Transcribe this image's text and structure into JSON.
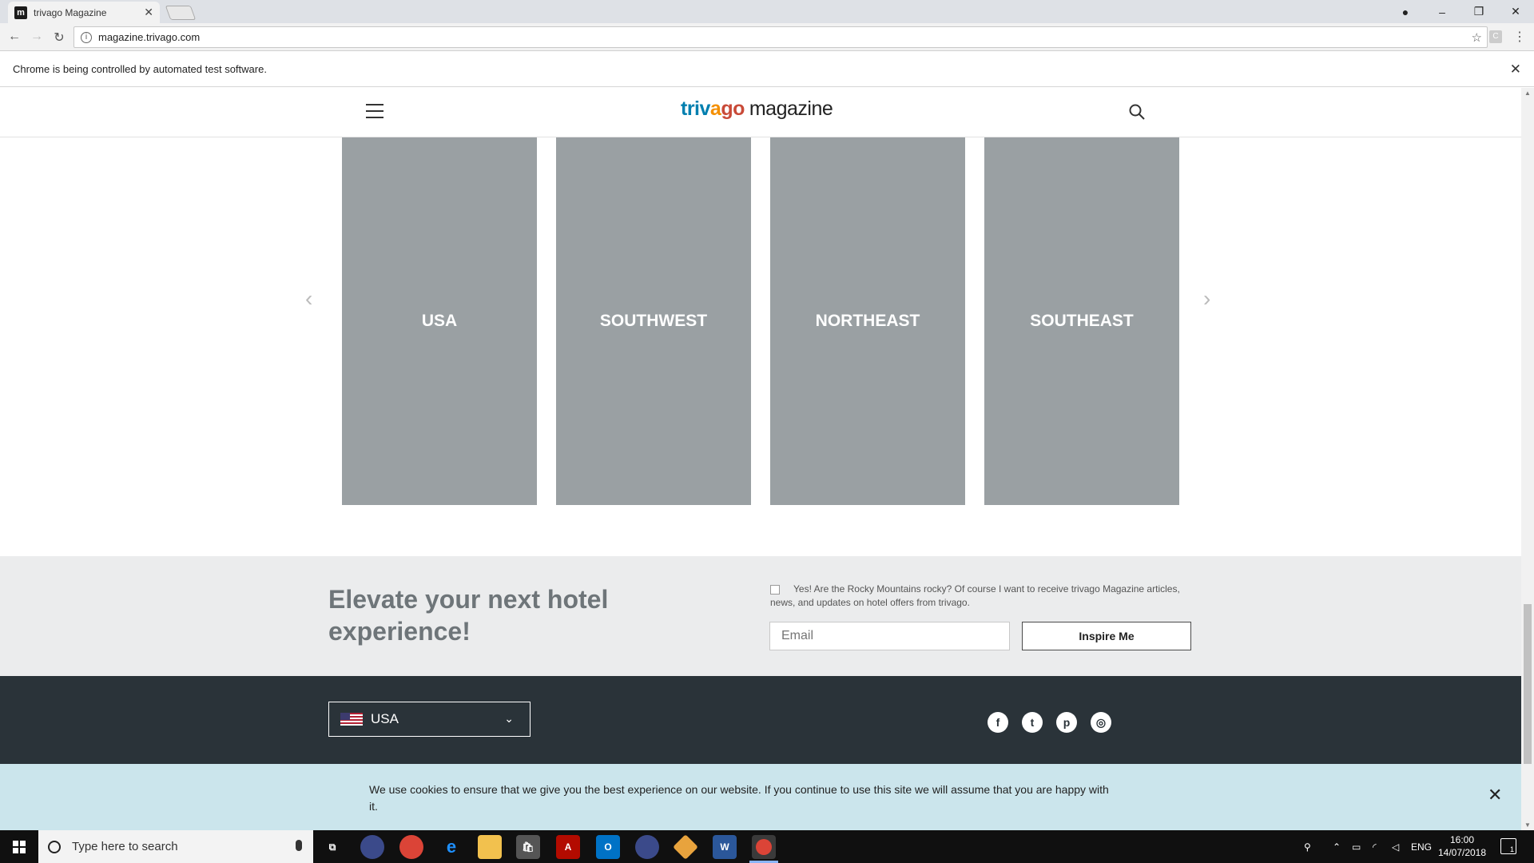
{
  "browser": {
    "tab_title": "trivago Magazine",
    "tab_favicon": "m",
    "url": "magazine.trivago.com",
    "infobar_text": "Chrome is being controlled by automated test software."
  },
  "header": {
    "logo_triv": "triv",
    "logo_a": "a",
    "logo_go": "go",
    "logo_magazine": "magazine"
  },
  "cards": [
    {
      "label": "USA"
    },
    {
      "label": "SOUTHWEST"
    },
    {
      "label": "NORTHEAST"
    },
    {
      "label": "SOUTHEAST"
    }
  ],
  "newsletter": {
    "heading": "Elevate your next hotel experience!",
    "consent_text": "Yes! Are the Rocky Mountains rocky? Of course I want to receive trivago Magazine articles, news, and updates on hotel offers from trivago.",
    "email_placeholder": "Email",
    "button_label": "Inspire Me"
  },
  "footer": {
    "country": "USA",
    "socials": [
      "facebook-icon",
      "twitter-icon",
      "pinterest-icon",
      "instagram-icon"
    ]
  },
  "cookie": {
    "text": "We use cookies to ensure that we give you the best experience on our website. If you continue to use this site we will assume that you are happy with it."
  },
  "taskbar": {
    "search_placeholder": "Type here to search",
    "language": "ENG",
    "time": "16:00",
    "date": "14/07/2018",
    "notification_count": "1"
  },
  "colors": {
    "card_gray": "#9aa0a3",
    "footer_dark": "#2a3339",
    "cookie_bg": "#cbe5ec",
    "newsletter_bg": "#ebeced",
    "logo_blue": "#007faf",
    "logo_orange": "#f48f00",
    "logo_red": "#c94a38"
  }
}
